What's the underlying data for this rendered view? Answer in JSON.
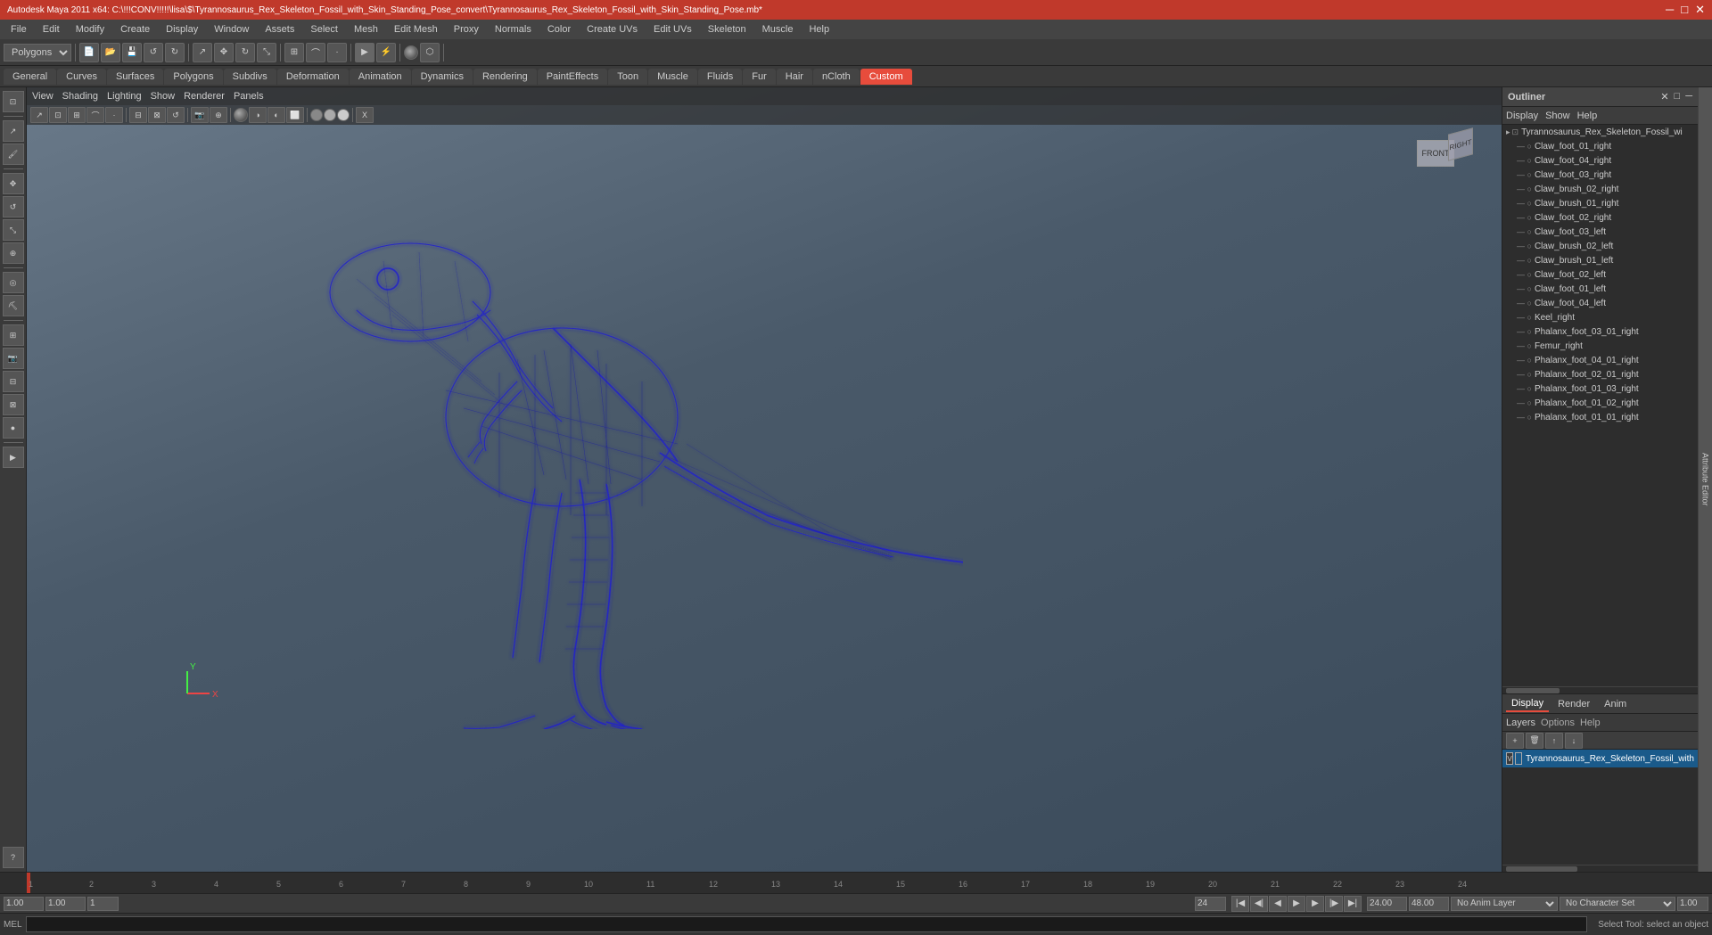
{
  "title": {
    "text": "Autodesk Maya 2011 x64: C:\\!!!CONV!!!!!\\lisa\\$\\Tyrannosaurus_Rex_Skeleton_Fossil_with_Skin_Standing_Pose_convert\\Tyrannosaurus_Rex_Skeleton_Fossil_with_Skin_Standing_Pose.mb*",
    "short": "Autodesk Maya 2011 x64"
  },
  "menu": {
    "items": [
      "File",
      "Edit",
      "Modify",
      "Create",
      "Display",
      "Window",
      "Assets",
      "Select",
      "Mesh",
      "Edit Mesh",
      "Proxy",
      "Normals",
      "Color",
      "Create UVs",
      "Edit UVs",
      "Skeleton",
      "Muscle",
      "Help"
    ]
  },
  "tabs": {
    "items": [
      "General",
      "Curves",
      "Surfaces",
      "Polygons",
      "Subdivs",
      "Deformation",
      "Animation",
      "Dynamics",
      "Rendering",
      "PaintEffects",
      "Toon",
      "Muscle",
      "Fluids",
      "Fur",
      "Hair",
      "nCloth",
      "Custom"
    ]
  },
  "viewport": {
    "menus": [
      "View",
      "Shading",
      "Lighting",
      "Show",
      "Renderer",
      "Panels"
    ],
    "view_labels": [
      "FRONT",
      "RIGHT"
    ]
  },
  "outliner": {
    "title": "Outliner",
    "menus": [
      "Display",
      "Show",
      "Help"
    ],
    "items": [
      {
        "name": "Tyrannosaurus_Rex_Skeleton_Fossil_wi",
        "indent": 0,
        "type": "root",
        "icon": "▸"
      },
      {
        "name": "Claw_foot_01_right",
        "indent": 1,
        "icon": "○"
      },
      {
        "name": "Claw_foot_04_right",
        "indent": 1,
        "icon": "○"
      },
      {
        "name": "Claw_foot_03_right",
        "indent": 1,
        "icon": "○"
      },
      {
        "name": "Claw_brush_02_right",
        "indent": 1,
        "icon": "○"
      },
      {
        "name": "Claw_brush_01_right",
        "indent": 1,
        "icon": "○"
      },
      {
        "name": "Claw_foot_02_right",
        "indent": 1,
        "icon": "○"
      },
      {
        "name": "Claw_foot_03_left",
        "indent": 1,
        "icon": "○"
      },
      {
        "name": "Claw_brush_02_left",
        "indent": 1,
        "icon": "○"
      },
      {
        "name": "Claw_brush_01_left",
        "indent": 1,
        "icon": "○"
      },
      {
        "name": "Claw_foot_02_left",
        "indent": 1,
        "icon": "○"
      },
      {
        "name": "Claw_foot_01_left",
        "indent": 1,
        "icon": "○"
      },
      {
        "name": "Claw_foot_04_left",
        "indent": 1,
        "icon": "○"
      },
      {
        "name": "Keel_right",
        "indent": 1,
        "icon": "○"
      },
      {
        "name": "Phalanx_foot_03_01_right",
        "indent": 1,
        "icon": "○"
      },
      {
        "name": "Femur_right",
        "indent": 1,
        "icon": "○"
      },
      {
        "name": "Phalanx_foot_04_01_right",
        "indent": 1,
        "icon": "○"
      },
      {
        "name": "Phalanx_foot_02_01_right",
        "indent": 1,
        "icon": "○"
      },
      {
        "name": "Phalanx_foot_01_03_right",
        "indent": 1,
        "icon": "○"
      },
      {
        "name": "Phalanx_foot_01_02_right",
        "indent": 1,
        "icon": "○"
      },
      {
        "name": "Phalanx_foot_01_01_right",
        "indent": 1,
        "icon": "○"
      }
    ]
  },
  "channel_box": {
    "tabs": [
      "Display",
      "Render",
      "Anim"
    ],
    "sub_tabs": [
      "Layers",
      "Options",
      "Help"
    ],
    "layer_item": "Tyrannosaurus_Rex_Skeleton_Fossil_with",
    "toolbar_icons": [
      "new-layer",
      "delete-layer",
      "move-up",
      "move-down"
    ]
  },
  "timeline": {
    "start": 1,
    "end": 24,
    "current": 1,
    "ticks": [
      1,
      1,
      2,
      3,
      4,
      5,
      6,
      7,
      8,
      9,
      10,
      11,
      12,
      13,
      14,
      15,
      16,
      17,
      18,
      19,
      20,
      21,
      22,
      23,
      24
    ],
    "labels": [
      "1",
      "2",
      "3",
      "4",
      "5",
      "6",
      "7",
      "8",
      "9",
      "10",
      "11",
      "12",
      "13",
      "14",
      "15",
      "16",
      "17",
      "18",
      "19",
      "20",
      "21",
      "22",
      "23",
      "24"
    ]
  },
  "bottom": {
    "range_start": "1.00",
    "range_end": "1.00",
    "current_frame": "1",
    "frame_end": "24",
    "anim_end": "24.00",
    "anim_end2": "48.00",
    "anim_set": "No Anim Layer",
    "char_set": "No Character Set",
    "playback_speed": "1.00"
  },
  "status": {
    "text": "Select Tool: select an object"
  },
  "mel": {
    "label": "MEL",
    "input_placeholder": ""
  },
  "colors": {
    "accent": "#e74c3c",
    "bg_dark": "#2d2d2d",
    "bg_mid": "#3a3a3a",
    "bg_light": "#444444",
    "viewport_bg1": "#6a7a8a",
    "viewport_bg2": "#3a4a5a",
    "trex_color": "#0a0a6a",
    "selected_layer": "#1a5a8a"
  },
  "attr_editor_label": "Attribute Editor",
  "right_view_label": "RIght"
}
